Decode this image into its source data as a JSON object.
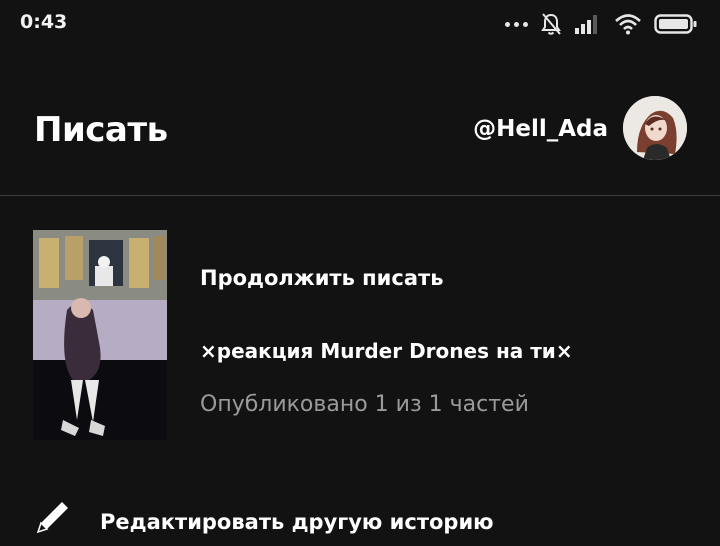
{
  "status_bar": {
    "time": "0:43",
    "icons": [
      "more-dots-icon",
      "bell-off-icon",
      "signal-icon",
      "wifi-icon",
      "battery-icon"
    ]
  },
  "header": {
    "title": "Писать",
    "username": "@Hell_Ada"
  },
  "continue_card": {
    "heading": "Продолжить писать",
    "story_title": "×реакция Murder Drones на ти×",
    "published_info": "Опубликовано 1 из 1 частей"
  },
  "actions": {
    "edit_other_label": "Редактировать другую историю"
  },
  "colors": {
    "background": "#121212",
    "text_primary": "#ffffff",
    "text_secondary": "#9a9a9a",
    "divider": "#3a3a3a"
  }
}
